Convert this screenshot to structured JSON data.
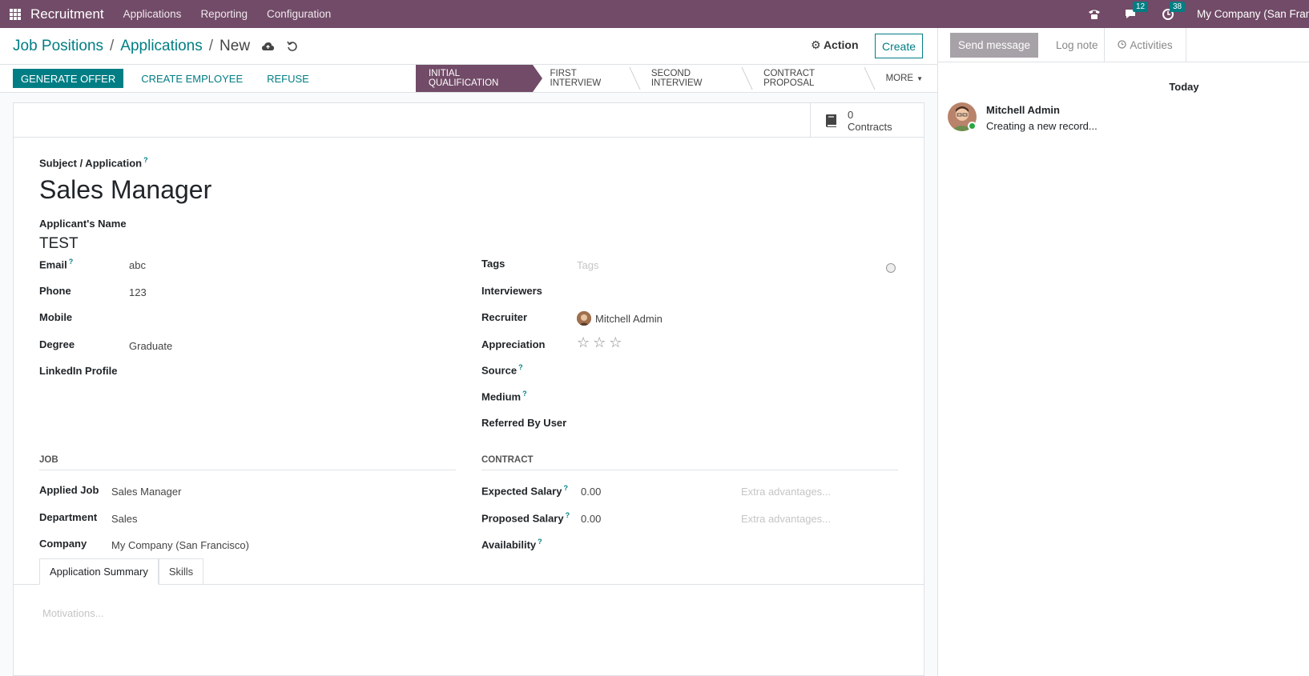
{
  "topbar": {
    "app_title": "Recruitment",
    "nav": [
      "Applications",
      "Reporting",
      "Configuration"
    ],
    "messages_count": "12",
    "activities_count": "38",
    "company": "My Company (San Francisco)"
  },
  "control": {
    "breadcrumb": [
      "Job Positions",
      "Applications"
    ],
    "current": "New",
    "action_label": "Action",
    "create_label": "Create"
  },
  "statusbar": {
    "generate_offer": "GENERATE OFFER",
    "create_employee": "CREATE EMPLOYEE",
    "refuse": "REFUSE",
    "stages": [
      "INITIAL QUALIFICATION",
      "FIRST INTERVIEW",
      "SECOND INTERVIEW",
      "CONTRACT PROPOSAL"
    ],
    "more": "MORE"
  },
  "smart_button": {
    "count": "0",
    "label": "Contracts"
  },
  "form": {
    "subject_label": "Subject / Application",
    "subject": "Sales Manager",
    "applicant_label": "Applicant's Name",
    "applicant": "TEST",
    "email_label": "Email",
    "email": "abc",
    "phone_label": "Phone",
    "phone": "123",
    "mobile_label": "Mobile",
    "degree_label": "Degree",
    "degree": "Graduate",
    "linkedin_label": "LinkedIn Profile",
    "tags_label": "Tags",
    "tags_placeholder": "Tags",
    "interviewers_label": "Interviewers",
    "recruiter_label": "Recruiter",
    "recruiter": "Mitchell Admin",
    "appreciation_label": "Appreciation",
    "appreciation_stars": 0,
    "source_label": "Source",
    "medium_label": "Medium",
    "referred_label": "Referred By User",
    "job_section": "JOB",
    "applied_job_label": "Applied Job",
    "applied_job": "Sales Manager",
    "department_label": "Department",
    "department": "Sales",
    "company_label": "Company",
    "company": "My Company (San Francisco)",
    "contract_section": "CONTRACT",
    "expected_salary_label": "Expected Salary",
    "expected_salary": "0.00",
    "expected_extra_placeholder": "Extra advantages...",
    "proposed_salary_label": "Proposed Salary",
    "proposed_salary": "0.00",
    "proposed_extra_placeholder": "Extra advantages...",
    "availability_label": "Availability"
  },
  "tabs": [
    "Application Summary",
    "Skills"
  ],
  "motivations_placeholder": "Motivations...",
  "chatter": {
    "send_message": "Send message",
    "log_note": "Log note",
    "activities": "Activities",
    "today": "Today",
    "author": "Mitchell Admin",
    "body": "Creating a new record..."
  }
}
